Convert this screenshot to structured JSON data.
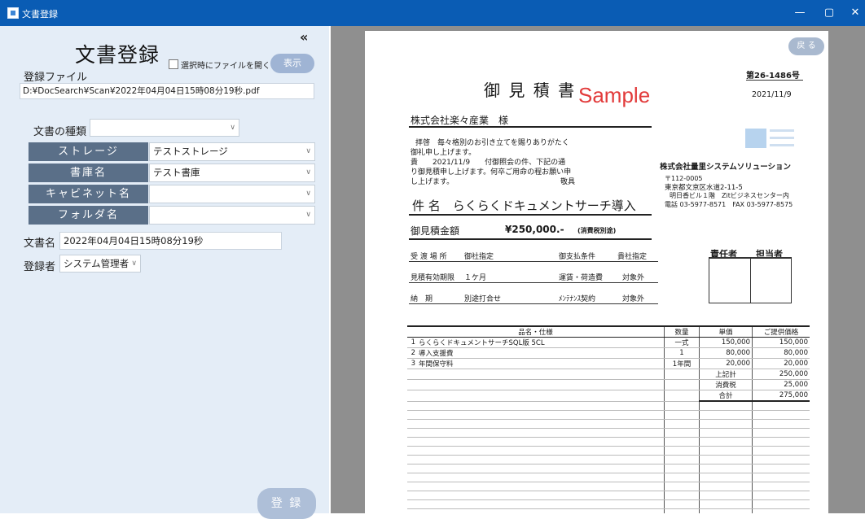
{
  "window": {
    "title": "文書登録",
    "controls": [
      "—",
      "▢",
      "✕"
    ]
  },
  "left_panel": {
    "title": "文書登録",
    "collapse_glyph": "«",
    "open_on_select_label": "選択時にファイルを開く",
    "show_button": "表示",
    "file_label": "登録ファイル",
    "file_path": "D:¥DocSearch¥Scan¥2022年04月04日15時08分19秒.pdf",
    "doc_type_label": "文書の種類",
    "doc_type_value": "",
    "storage_label": "ストレージ",
    "storage_value": "テストストレージ",
    "library_label": "書庫名",
    "library_value": "テスト書庫",
    "cabinet_label": "キャビネット名",
    "cabinet_value": "",
    "folder_label": "フォルダ名",
    "folder_value": "",
    "doc_name_label": "文書名",
    "doc_name_value": "2022年04月04日15時08分19秒",
    "registrant_label": "登録者",
    "registrant_value": "システム管理者",
    "register_button": "登 録"
  },
  "viewer": {
    "back_button": "戻 る",
    "document": {
      "number": "第26-1486号",
      "date": "2021/11/9",
      "title": "御 見 積 書",
      "sample_mark": "Sample",
      "addressee": "株式会社楽々産業　様",
      "greeting_1": "拝啓　毎々格別のお引き立てを賜りありがたく",
      "greeting_2": "御礼申し上げます。",
      "greeting_3": "貴　　2021/11/9　　付御照会の件、下記の通",
      "greeting_4": "り御見積申し上げます。何卒ご用命の程お願い申",
      "greeting_5": "し上げます。",
      "greeting_6": "敬具",
      "company_name": "株式会社量里システムソリューション",
      "postal": "〒112-0005",
      "address_1": "東京都文京区水道2-11-5",
      "address_2": "明日香ビル１階　Zitビジネスセンター内",
      "phone": "電話 03-5977-8571　FAX 03-5977-8575",
      "subject": "件 名　らくらくドキュメントサーチ導入",
      "amount_label": "御見積金額",
      "amount_value": "¥250,000.-",
      "amount_note": "(消費税別途)",
      "delivery_place_label": "受 渡 場 所",
      "delivery_place_value": "御社指定",
      "payment_label": "御支払条件",
      "payment_value": "貴社指定",
      "validity_label": "見積有効期限",
      "validity_value": "１ケ月",
      "shipping_label": "運賃・荷造費",
      "shipping_value": "対象外",
      "delivery_label": "納　期",
      "delivery_value": "別途打合せ",
      "maint_label": "ﾒﾝﾃﾅﾝｽ契約",
      "maint_value": "対象外",
      "responsible_label": "責任者",
      "staff_label": "担当者",
      "table_headers": [
        "品名・仕様",
        "数量",
        "単価",
        "ご提供価格"
      ],
      "rows": [
        [
          "1",
          "らくらくドキュメントサーチSQL版 5CL",
          "一式",
          "150,000",
          "150,000"
        ],
        [
          "2",
          "導入支援費",
          "1",
          "80,000",
          "80,000"
        ],
        [
          "3",
          "年間保守料",
          "1年間",
          "20,000",
          "20,000"
        ]
      ],
      "subtotal_label": "上記計",
      "subtotal_value": "250,000",
      "tax_label": "消費税",
      "tax_value": "25,000",
      "total_label": "合計",
      "total_value": "275,000"
    }
  }
}
